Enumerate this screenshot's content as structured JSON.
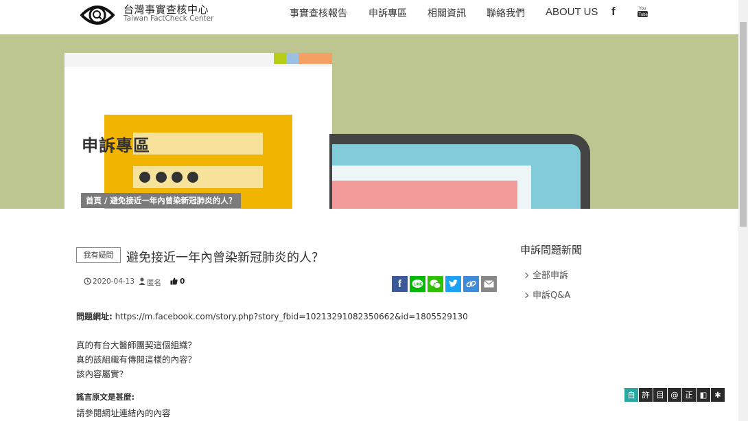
{
  "header": {
    "site_name_zh": "台灣事實查核中心",
    "site_name_en": "Taiwan FactCheck Center",
    "nav": [
      "事實查核報告",
      "申訴專區",
      "相關資訊",
      "聯絡我們",
      "ABOUT US"
    ],
    "facebook_glyph": "f",
    "youtube_icon": "youtube-icon"
  },
  "hero": {
    "title": "申訴專區",
    "breadcrumb": "首頁 / 避免接近一年內曾染新冠肺炎的人？",
    "colors": {
      "background": "#bdc690",
      "yellow": "#f1b400",
      "pink": "#f29a9a",
      "cyan": "#82cbd9"
    }
  },
  "post": {
    "tag": "我有疑問",
    "title": "避免接近一年內曾染新冠肺炎的人？",
    "date": "2020-04-13",
    "author": "匿名",
    "likes": "0",
    "share_icons": [
      "facebook-icon",
      "line-icon",
      "wechat-icon",
      "twitter-icon",
      "link-icon",
      "email-icon"
    ],
    "url_label": "問題網址:",
    "url": "https://m.facebook.com/story.php?story_fbid=10213291082350662&id=1805529130",
    "questions": [
      "真的有台大醫師團契這個組織？",
      "真的該組織有傳閱這樣的內容？",
      "該內容屬實？"
    ],
    "rumor_label": "謠言原文是甚麼:",
    "rumor_text": "請參閱網址連結內的內容"
  },
  "sidebar": {
    "title": "申訴問題新聞",
    "items": [
      "全部申訴",
      "申訴Q&A"
    ]
  },
  "a11y_toolbar": [
    "自",
    "許",
    "目",
    "@",
    "正",
    "◧",
    "✱"
  ]
}
